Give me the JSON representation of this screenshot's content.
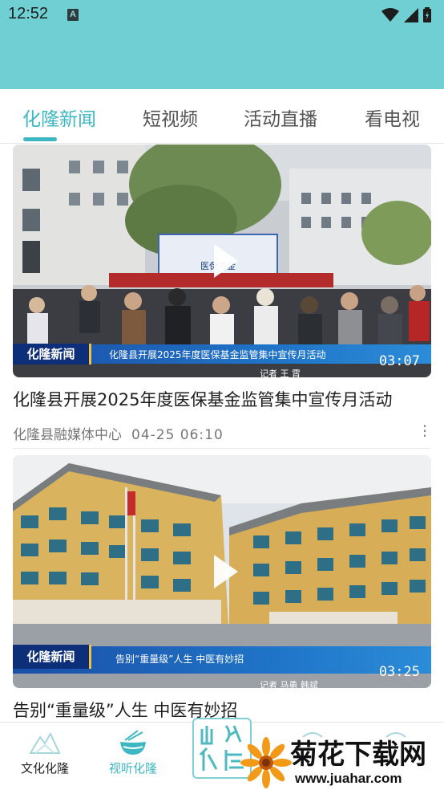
{
  "status_bar": {
    "time": "12:52",
    "notification_icon": "A"
  },
  "tabs": [
    {
      "label": "化隆新闻",
      "active": true
    },
    {
      "label": "短视频",
      "active": false
    },
    {
      "label": "活动直播",
      "active": false
    },
    {
      "label": "看电视",
      "active": false
    }
  ],
  "articles": [
    {
      "duration": "03:07",
      "banner_logo": "化隆新闻",
      "banner_text": "化隆县开展2025年度医保基金监管集中宣传月活动",
      "reporter": "记者  王 霄",
      "stage_text": "医保基金",
      "title": "化隆县开展2025年度医保基金监管集中宣传月活动",
      "source": "化隆县融媒体中心",
      "date": "04-25  06:10"
    },
    {
      "duration": "03:25",
      "banner_logo": "化隆新闻",
      "banner_text": "告别“重量级”人生  中医有妙招",
      "reporter": "记者   马勇  韩斌",
      "title": "告别“重量级”人生  中医有妙招"
    }
  ],
  "bottom_nav": [
    {
      "label": "文化化隆",
      "active": false,
      "icon": "mountain-icon"
    },
    {
      "label": "视听化隆",
      "active": true,
      "icon": "noodle-bowl-icon"
    }
  ],
  "center_logo_text": "山水化隆",
  "watermark": {
    "title": "菊花下载网",
    "url": "www.juahar.com"
  },
  "colors": {
    "accent": "#3db7c2",
    "header": "#70cfd2"
  }
}
